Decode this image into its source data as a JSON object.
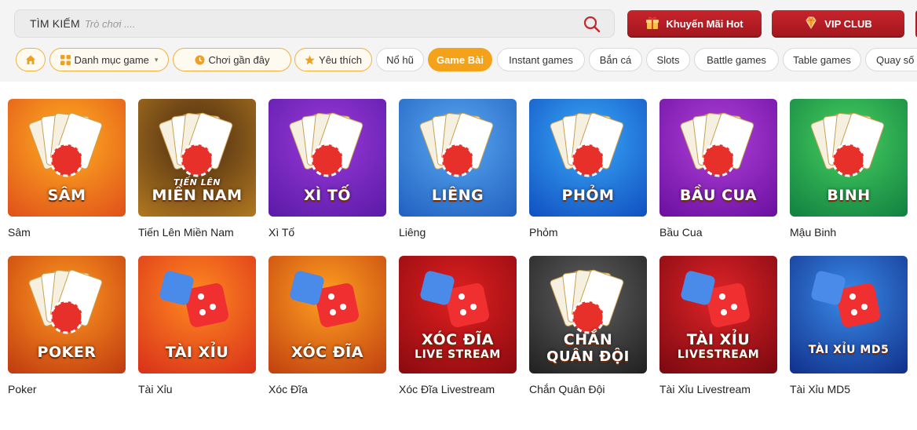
{
  "search": {
    "label": "TÌM KIẾM",
    "placeholder": "Trò chơi ...."
  },
  "promos": {
    "km_label": "Khuyến Mãi Hot",
    "vip_label": "VIP CLUB",
    "color": "#b81c24"
  },
  "chips": [
    {
      "label": "",
      "icon": "home-icon"
    },
    {
      "label": "Danh mục game",
      "icon": "grid-icon"
    },
    {
      "label": "Chơi gần đây",
      "icon": "clock-icon"
    },
    {
      "label": "Yêu thích",
      "icon": "star-icon"
    },
    {
      "label": "Nổ hũ"
    },
    {
      "label": "Game Bài",
      "active": true
    },
    {
      "label": "Instant games"
    },
    {
      "label": "Bắn cá"
    },
    {
      "label": "Slots"
    },
    {
      "label": "Battle games"
    },
    {
      "label": "Table games"
    },
    {
      "label": "Quay số"
    }
  ],
  "accent": "#f3a21a",
  "games": [
    {
      "name": "Sâm",
      "thumb_title": "SÂM",
      "bg": [
        "#ffb020",
        "#e0501a"
      ]
    },
    {
      "name": "Tiến Lên Miền Nam",
      "thumb_title": "MIỀN NAM",
      "thumb_sub": "TIẾN LÊN",
      "bg": [
        "#4a2a10",
        "#b07820"
      ]
    },
    {
      "name": "Xì Tố",
      "thumb_title": "XÌ TỐ",
      "bg": [
        "#9a3ad8",
        "#5a1aa8"
      ]
    },
    {
      "name": "Liêng",
      "thumb_title": "LIÊNG",
      "bg": [
        "#5aa8f0",
        "#2060c0"
      ]
    },
    {
      "name": "Phỏm",
      "thumb_title": "PHỎM",
      "bg": [
        "#3aa8f8",
        "#1050c0"
      ]
    },
    {
      "name": "Bầu Cua",
      "thumb_title": "BẦU CUA",
      "bg": [
        "#b040d8",
        "#6a10a0"
      ]
    },
    {
      "name": "Mậu Binh",
      "thumb_title": "BINH",
      "bg": [
        "#48d060",
        "#108040"
      ]
    },
    {
      "name": "Poker",
      "thumb_title": "POKER",
      "bg": [
        "#ff9a20",
        "#c03a10"
      ]
    },
    {
      "name": "Tài Xỉu",
      "thumb_title": "TÀI XỈU",
      "bg": [
        "#ff8a20",
        "#d8301a"
      ]
    },
    {
      "name": "Xóc Đĩa",
      "thumb_title": "XÓC ĐĨA",
      "bg": [
        "#ffa020",
        "#c04010"
      ]
    },
    {
      "name": "Xóc Đĩa Livestream",
      "thumb_title": "XÓC ĐĨA",
      "thumb_sub2": "LIVE STREAM",
      "bg": [
        "#e02020",
        "#8a0a10"
      ]
    },
    {
      "name": "Chắn Quân Đội",
      "thumb_title": "CHẮN",
      "thumb_sub2": "QUÂN ĐỘI",
      "bg": [
        "#606060",
        "#202020"
      ]
    },
    {
      "name": "Tài Xỉu Livestream",
      "thumb_title": "TÀI XỈU",
      "thumb_sub2": "LIVESTREAM",
      "bg": [
        "#e02428",
        "#7a0810"
      ]
    },
    {
      "name": "Tài Xỉu MD5",
      "thumb_title": "TÀI XỈU MD5",
      "bg": [
        "#3a8ae8",
        "#10308a"
      ]
    }
  ]
}
